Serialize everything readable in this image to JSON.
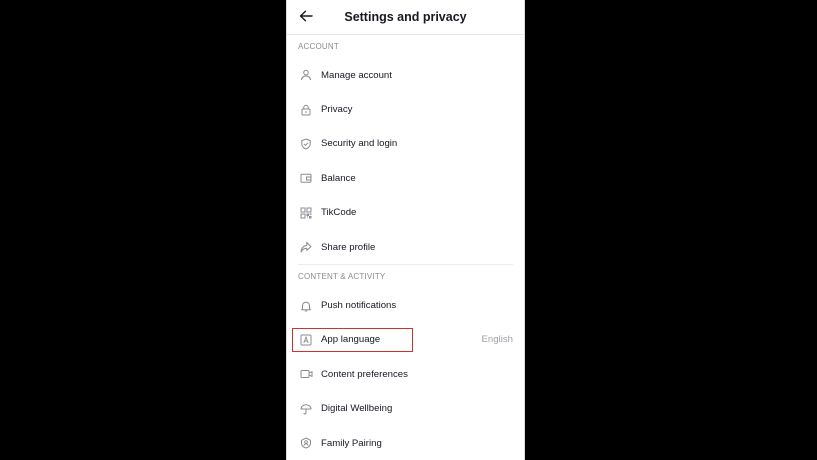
{
  "header": {
    "title": "Settings and privacy"
  },
  "sections": {
    "account": "ACCOUNT",
    "content_activity": "CONTENT & ACTIVITY"
  },
  "account_items": [
    {
      "label": "Manage account",
      "icon": "person-icon"
    },
    {
      "label": "Privacy",
      "icon": "lock-icon"
    },
    {
      "label": "Security and login",
      "icon": "shield-icon"
    },
    {
      "label": "Balance",
      "icon": "wallet-icon"
    },
    {
      "label": "TikCode",
      "icon": "qr-code-icon"
    },
    {
      "label": "Share profile",
      "icon": "share-icon"
    }
  ],
  "content_items": [
    {
      "label": "Push notifications",
      "icon": "bell-icon"
    },
    {
      "label": "App language",
      "value": "English",
      "icon": "language-icon",
      "highlight_color": "#d0312d"
    },
    {
      "label": "Content preferences",
      "icon": "video-icon"
    },
    {
      "label": "Digital Wellbeing",
      "icon": "umbrella-icon"
    },
    {
      "label": "Family Pairing",
      "icon": "family-icon"
    }
  ]
}
